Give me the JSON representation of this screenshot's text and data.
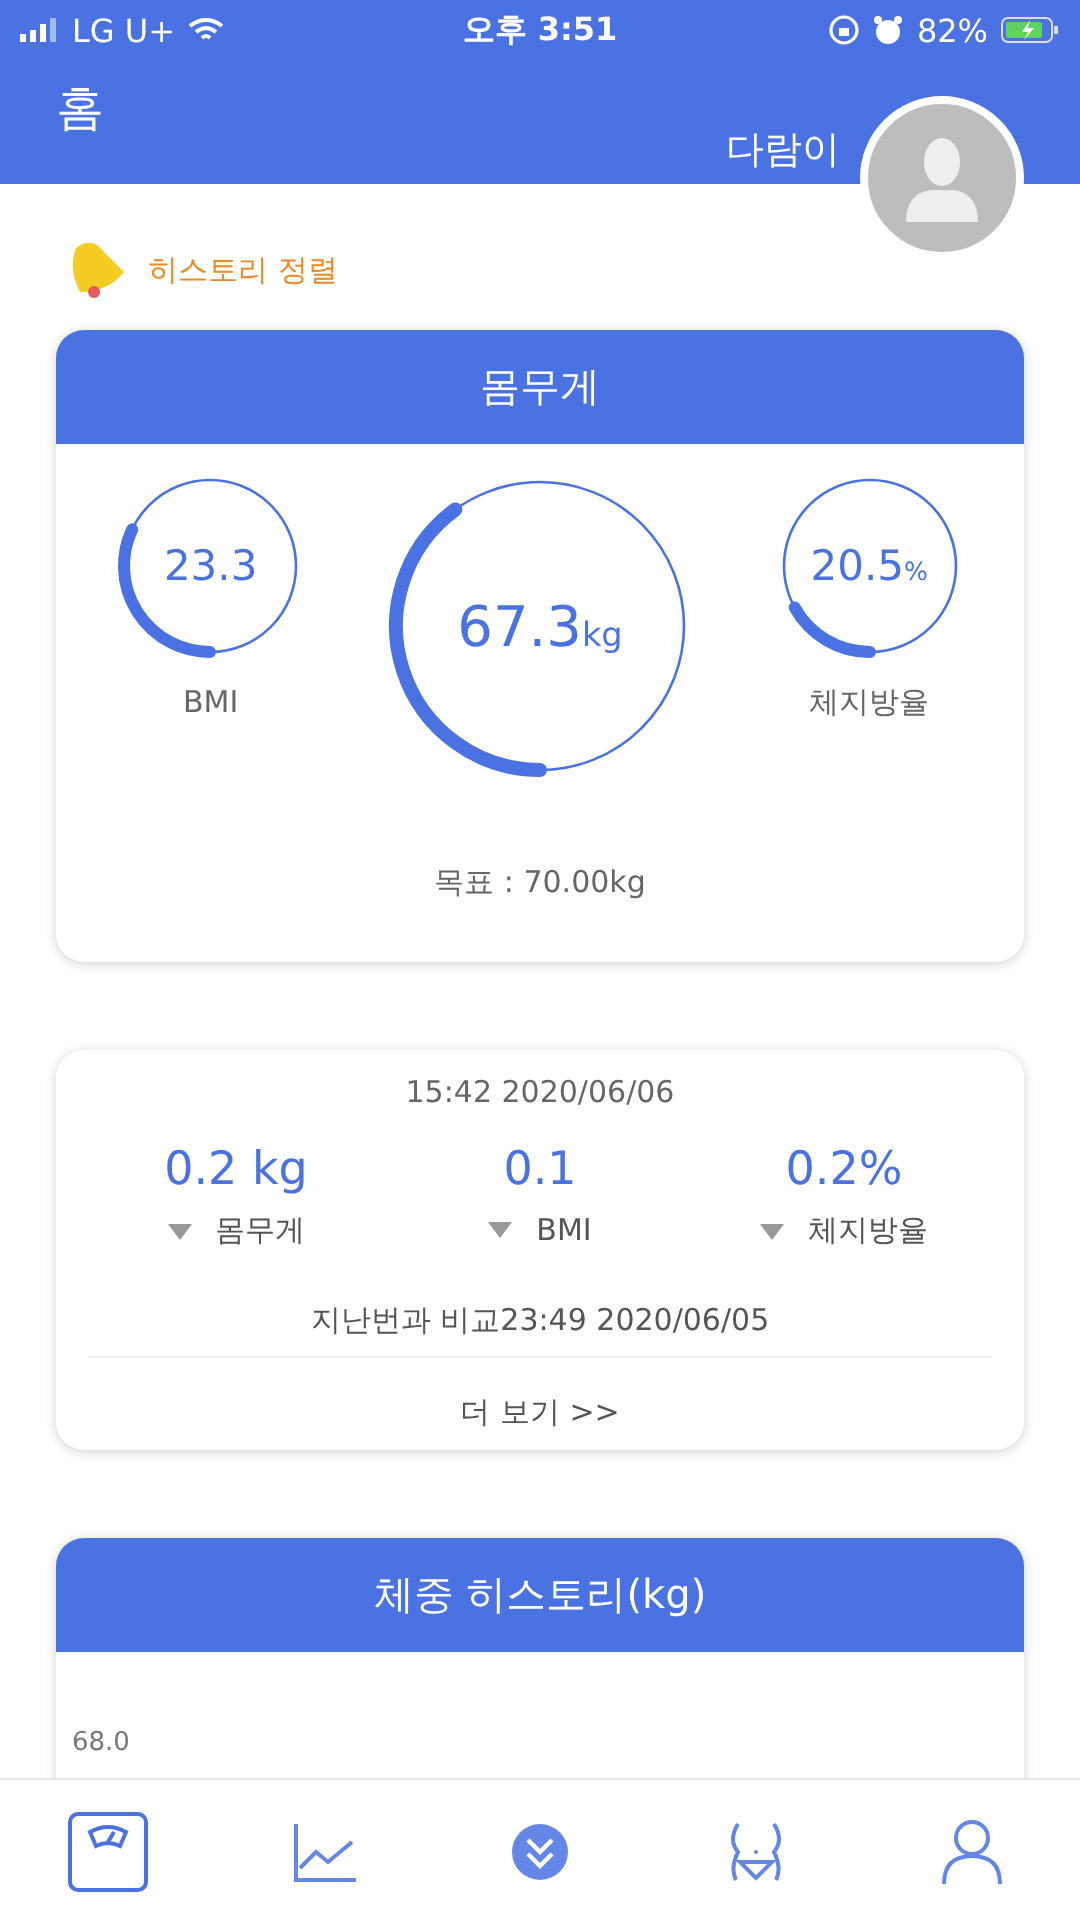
{
  "status_bar": {
    "carrier": "LG U+",
    "time": "오후 3:51",
    "battery": "82%"
  },
  "header": {
    "title": "홈",
    "user_name": "다람이"
  },
  "history_sort": {
    "label": "히스토리 정렬"
  },
  "weight_card": {
    "title": "몸무게",
    "gauges": [
      {
        "kind": "small",
        "value": "23.3",
        "label": "BMI"
      },
      {
        "kind": "large",
        "value": "67.3",
        "unit": "kg"
      },
      {
        "kind": "small",
        "value": "20.5",
        "unit": "%",
        "label": "체지방율"
      }
    ],
    "goal": "목표 : 70.00kg"
  },
  "compare_card": {
    "date": "15:42 2020/06/06",
    "items": [
      {
        "value": "0.2 kg",
        "label": "몸무게"
      },
      {
        "value": "0.1",
        "label": "BMI"
      },
      {
        "value": "0.2%",
        "label": "체지방율"
      }
    ],
    "compared_to": "지난번과 비교23:49 2020/06/05",
    "more": "더 보기 >>"
  },
  "history_card": {
    "title": "체중 히스토리(kg)",
    "y_label": "68.0"
  },
  "bottom_nav": [
    {
      "kind": "scale",
      "selected": true
    },
    {
      "kind": "chart",
      "selected": false
    },
    {
      "kind": "more",
      "selected": false
    },
    {
      "kind": "body",
      "selected": false
    },
    {
      "kind": "profile",
      "selected": false
    }
  ]
}
